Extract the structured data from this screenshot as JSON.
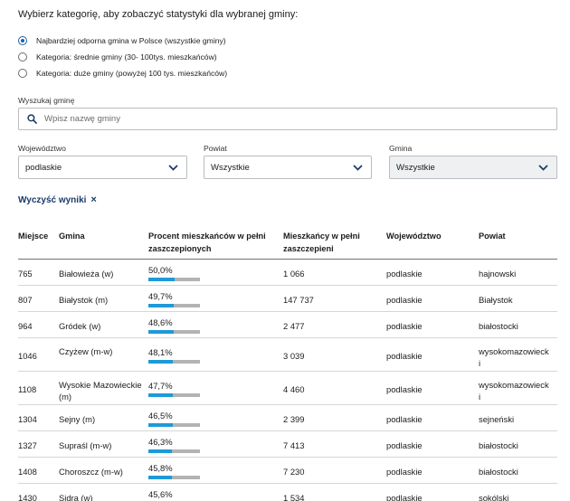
{
  "intro_text": "Wybierz kategorię, aby zobaczyć statystyki dla wybranej gminy:",
  "radio_options": [
    {
      "label": "Najbardziej odporna gmina w Polsce (wszystkie gminy)",
      "checked": true
    },
    {
      "label": "Kategoria: średnie gminy (30- 100tys. mieszkańców)",
      "checked": false
    },
    {
      "label": "Kategoria: duże gminy (powyżej 100 tys. mieszkańców)",
      "checked": false
    }
  ],
  "search": {
    "label": "Wyszukaj gminę",
    "placeholder": "Wpisz nazwę gminy",
    "icon": "search-icon"
  },
  "filters": {
    "wojewodztwo": {
      "label": "Województwo",
      "value": "podlaskie"
    },
    "powiat": {
      "label": "Powiat",
      "value": "Wszystkie"
    },
    "gmina": {
      "label": "Gmina",
      "value": "Wszystkie"
    }
  },
  "clear_label": "Wyczyść wyniki",
  "clear_icon": "×",
  "table": {
    "headers": {
      "miejsce": "Miejsce",
      "gmina": "Gmina",
      "procent_line1": "Procent mieszkańców w pełni",
      "procent_line2": "zaszczepionych",
      "mieszkancy_line1": "Mieszkańcy w pełni",
      "mieszkancy_line2": "zaszczepieni",
      "wojewodztwo": "Województwo",
      "powiat": "Powiat"
    },
    "rows": [
      {
        "miejsce": "765",
        "gmina": "Białowieża (w)",
        "gmina2": "",
        "procent": "50,0%",
        "fraction": 0.5,
        "mieszkancy": "1 066",
        "wojewodztwo": "podlaskie",
        "powiat": "hajnowski",
        "powiat2": ""
      },
      {
        "miejsce": "807",
        "gmina": "Białystok (m)",
        "gmina2": "",
        "procent": "49,7%",
        "fraction": 0.497,
        "mieszkancy": "147 737",
        "wojewodztwo": "podlaskie",
        "powiat": "Białystok",
        "powiat2": ""
      },
      {
        "miejsce": "964",
        "gmina": "Gródek (w)",
        "gmina2": "",
        "procent": "48,6%",
        "fraction": 0.486,
        "mieszkancy": "2 477",
        "wojewodztwo": "podlaskie",
        "powiat": "białostocki",
        "powiat2": ""
      },
      {
        "miejsce": "1046",
        "gmina": "Czyżew (m-w)",
        "gmina2": "",
        "procent": "48,1%",
        "fraction": 0.481,
        "mieszkancy": "3 039",
        "wojewodztwo": "podlaskie",
        "powiat": "wysokomazowieck",
        "powiat2": "i"
      },
      {
        "miejsce": "1108",
        "gmina": "Wysokie Mazowieckie",
        "gmina2": "(m)",
        "procent": "47,7%",
        "fraction": 0.477,
        "mieszkancy": "4 460",
        "wojewodztwo": "podlaskie",
        "powiat": "wysokomazowieck",
        "powiat2": "i"
      },
      {
        "miejsce": "1304",
        "gmina": "Sejny (m)",
        "gmina2": "",
        "procent": "46,5%",
        "fraction": 0.465,
        "mieszkancy": "2 399",
        "wojewodztwo": "podlaskie",
        "powiat": "sejneński",
        "powiat2": ""
      },
      {
        "miejsce": "1327",
        "gmina": "Supraśl (m-w)",
        "gmina2": "",
        "procent": "46,3%",
        "fraction": 0.463,
        "mieszkancy": "7 413",
        "wojewodztwo": "podlaskie",
        "powiat": "białostocki",
        "powiat2": ""
      },
      {
        "miejsce": "1408",
        "gmina": "Choroszcz (m-w)",
        "gmina2": "",
        "procent": "45,8%",
        "fraction": 0.458,
        "mieszkancy": "7 230",
        "wojewodztwo": "podlaskie",
        "powiat": "białostocki",
        "powiat2": ""
      },
      {
        "miejsce": "1430",
        "gmina": "Sidra (w)",
        "gmina2": "",
        "procent": "45,6%",
        "fraction": 0.456,
        "mieszkancy": "1 534",
        "wojewodztwo": "podlaskie",
        "powiat": "sokólski",
        "powiat2": ""
      }
    ]
  },
  "colors": {
    "accent": "#1d5fa8",
    "bar_fill": "#1e9ad8",
    "bar_track": "#b3b3b3",
    "clear_link": "#1b3a6b"
  }
}
